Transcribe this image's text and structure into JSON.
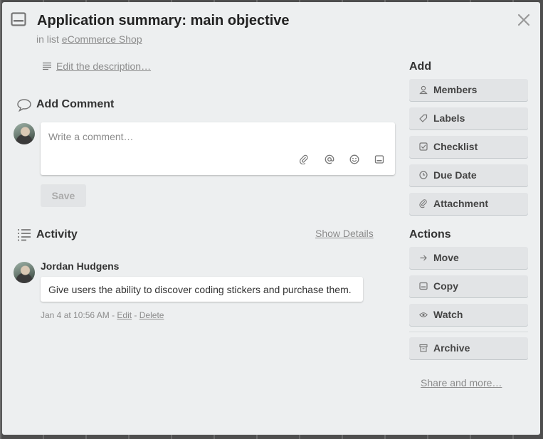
{
  "card": {
    "title": "Application summary: main objective",
    "in_list_prefix": "in list",
    "list_name": "eCommerce Shop",
    "edit_description": "Edit the description…"
  },
  "comment": {
    "heading": "Add Comment",
    "placeholder": "Write a comment…",
    "save_label": "Save",
    "tools": [
      "attachment-icon",
      "mention-icon",
      "emoji-icon",
      "card-icon"
    ]
  },
  "activity": {
    "heading": "Activity",
    "show_details": "Show Details",
    "items": [
      {
        "author": "Jordan Hudgens",
        "text": "Give users the ability to discover coding stickers and purchase them.",
        "time": "Jan 4 at 10:56 AM",
        "edit": "Edit",
        "delete": "Delete"
      }
    ]
  },
  "sidebar": {
    "add_heading": "Add",
    "add_items": [
      {
        "label": "Members",
        "icon": "person-icon"
      },
      {
        "label": "Labels",
        "icon": "tag-icon"
      },
      {
        "label": "Checklist",
        "icon": "checkbox-icon"
      },
      {
        "label": "Due Date",
        "icon": "clock-icon"
      },
      {
        "label": "Attachment",
        "icon": "paperclip-icon"
      }
    ],
    "actions_heading": "Actions",
    "action_items": [
      {
        "label": "Move",
        "icon": "arrow-right-icon"
      },
      {
        "label": "Copy",
        "icon": "copy-icon"
      },
      {
        "label": "Watch",
        "icon": "eye-icon"
      },
      {
        "label": "Archive",
        "icon": "archive-icon"
      }
    ],
    "share": "Share and more…"
  }
}
